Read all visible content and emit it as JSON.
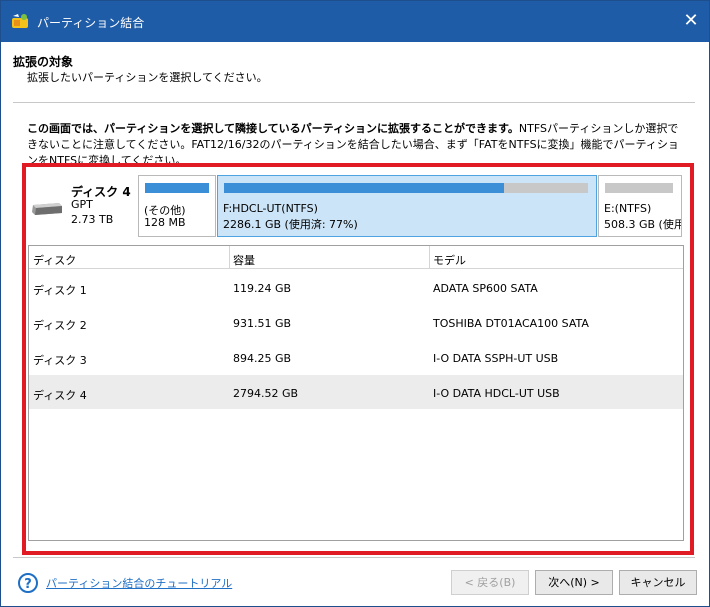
{
  "window": {
    "title": "パーティション結合",
    "close_icon": "close-icon"
  },
  "header": {
    "title": "拡張の対象",
    "subtitle": "拡張したいパーティションを選択してください。"
  },
  "description": {
    "bold": "この画面では、パーティションを選択して隣接しているパーティションに拡張することができます。",
    "normal": "NTFSパーティションしか選択できないことに注意してください。FAT12/16/32のパーティションを結合したい場合、まず「FATをNTFSに変換」機能でパーティションをNTFSに変換してください。"
  },
  "disk_map": {
    "disk": {
      "name": "ディスク 4",
      "type": "GPT",
      "size": "2.73 TB"
    },
    "partitions": [
      {
        "label": "(その他)",
        "detail": "128 MB",
        "used_fraction": 1.0,
        "selected": false
      },
      {
        "label": "F:HDCL-UT(NTFS)",
        "detail": "2286.1 GB (使用済: 77%)",
        "used_fraction": 0.77,
        "selected": true
      },
      {
        "label": "E:(NTFS)",
        "detail": "508.3 GB (使用",
        "used_fraction": 0.0,
        "selected": false
      }
    ]
  },
  "table": {
    "columns": [
      "ディスク",
      "容量",
      "モデル"
    ],
    "rows": [
      {
        "disk": "ディスク 1",
        "capacity": "119.24 GB",
        "model": "ADATA SP600 SATA",
        "selected": false
      },
      {
        "disk": "ディスク 2",
        "capacity": "931.51 GB",
        "model": "TOSHIBA DT01ACA100 SATA",
        "selected": false
      },
      {
        "disk": "ディスク 3",
        "capacity": "894.25 GB",
        "model": "I-O DATA SSPH-UT USB",
        "selected": false
      },
      {
        "disk": "ディスク 4",
        "capacity": "2794.52 GB",
        "model": "I-O DATA HDCL-UT USB",
        "selected": true
      }
    ]
  },
  "footer": {
    "help_link": "パーティション結合のチュートリアル",
    "back_button": "< 戻る(B)",
    "next_button": "次へ(N) >",
    "cancel_button": "キャンセル"
  },
  "colors": {
    "title_bar": "#1f5ca8",
    "highlight": "#e01b24",
    "bar_fill": "#3a8fd6"
  }
}
